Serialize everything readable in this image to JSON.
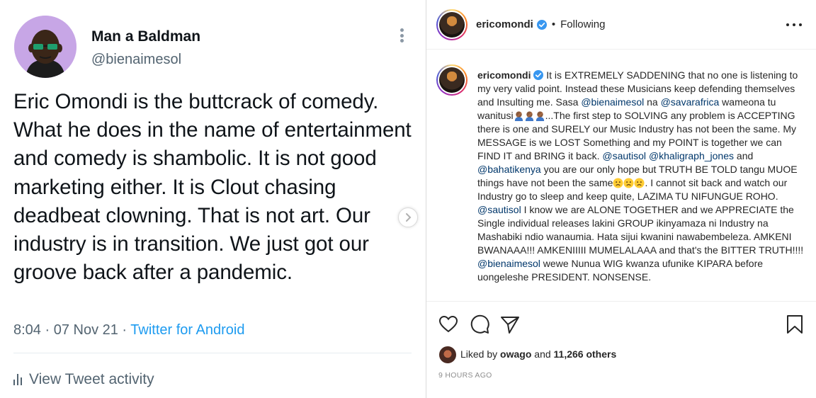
{
  "tweet": {
    "display_name": "Man a Baldman",
    "handle": "@bienaimesol",
    "text": "Eric Omondi is the buttcrack of comedy. What he does in the name of entertainment and comedy is shambolic. It is not good marketing either. It is Clout chasing deadbeat clowning. That is not art. Our industry is in transition. We just got our groove back after a pandemic.",
    "time_date": "8:04 · 07 Nov 21 · ",
    "source": "Twitter for Android",
    "activity_label": "View Tweet activity"
  },
  "instagram": {
    "username": "ericomondi",
    "separator": "•",
    "follow_state": "Following",
    "caption_username": "ericomondi",
    "caption": [
      {
        "t": "It is EXTREMELY SADDENING that no one is listening to my very valid point. Instead these Musicians keep defending themselves and Insulting me. Sasa "
      },
      {
        "m": "@bienaimesol"
      },
      {
        "t": " na "
      },
      {
        "m": "@savarafrica"
      },
      {
        "t": " wameona tu wanitusi"
      },
      {
        "e": "facepalm"
      },
      {
        "e": "facepalm"
      },
      {
        "e": "facepalm"
      },
      {
        "t": "...The first step to SOLVING any problem is ACCEPTING there is one and SURELY our Music Industry has not been the same. My MESSAGE is we LOST Something and my POINT is together we can FIND IT and BRING it back. "
      },
      {
        "m": "@sautisol"
      },
      {
        "t": " "
      },
      {
        "m": "@khaligraph_jones"
      },
      {
        "t": " and "
      },
      {
        "m": "@bahatikenya"
      },
      {
        "t": " you are our only hope but TRUTH BE TOLD tangu MUOE things have not been the same"
      },
      {
        "e": "sad"
      },
      {
        "e": "sad"
      },
      {
        "e": "sad"
      },
      {
        "t": ". I cannot sit back and watch our Industry go to sleep and keep quite, LAZIMA TU NIFUNGUE ROHO. "
      },
      {
        "m": "@sautisol"
      },
      {
        "t": " I know we are ALONE TOGETHER and we APPRECIATE the Single individual releases lakini GROUP ikinyamaza ni Industry na Mashabiki ndio wanaumia. Hata sijui kwanini nawabembeleza. AMKENI BWANAAA!!! AMKENIIIII MUMELALAAA and that's the BITTER TRUTH!!!! "
      },
      {
        "m": "@bienaimesol"
      },
      {
        "t": " wewe Nunua WIG kwanza ufunike KIPARA before uongeleshe PRESIDENT. NONSENSE."
      }
    ],
    "liked_by_prefix": "Liked by ",
    "liked_by_user": "owago",
    "liked_by_and": " and ",
    "liked_by_count": "11,266 others",
    "timestamp": "9 HOURS AGO",
    "colors": {
      "mention": "#00376b",
      "twitter_blue": "#1d9bf0",
      "verified_blue": "#3897f0"
    }
  }
}
